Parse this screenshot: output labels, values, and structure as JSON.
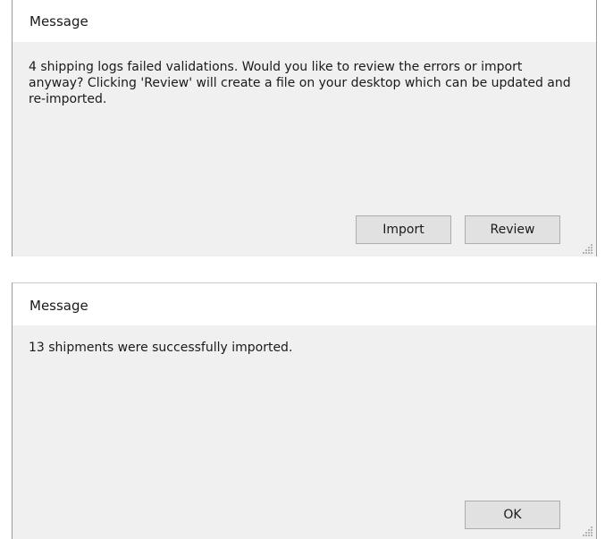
{
  "dialogs": [
    {
      "title": "Message",
      "message": "4 shipping logs failed validations. Would you like to review the errors or import anyway? Clicking 'Review' will create a file on your desktop which can be updated and re-imported.",
      "buttons": {
        "import": "Import",
        "review": "Review"
      }
    },
    {
      "title": "Message",
      "message": "13 shipments were successfully imported.",
      "buttons": {
        "ok": "OK"
      }
    }
  ],
  "icons": [
    "resize-grip-icon"
  ],
  "colors": {
    "titlebar_bg": "#ffffff",
    "dialog_bg": "#f0f0f0",
    "button_bg": "#e1e1e1",
    "button_border": "#adadad"
  }
}
